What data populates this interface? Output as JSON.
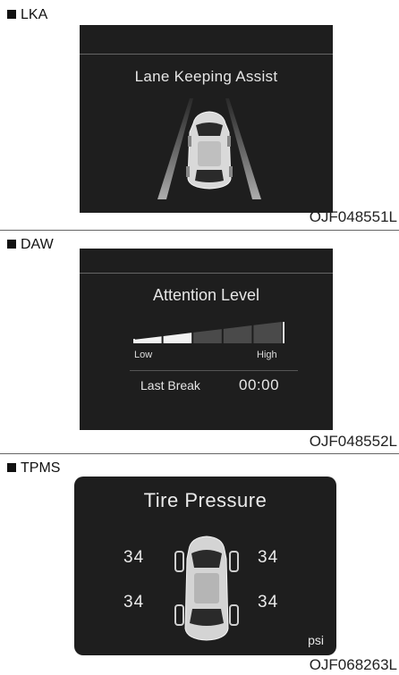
{
  "lka": {
    "section_label": "LKA",
    "screen_title": "Lane Keeping Assist",
    "figure_code": "OJF048551L"
  },
  "daw": {
    "section_label": "DAW",
    "screen_title": "Attention Level",
    "low_label": "Low",
    "high_label": "High",
    "attention_level_filled_segments": 2,
    "attention_level_total_segments": 5,
    "last_break_label": "Last Break",
    "last_break_time": "00:00",
    "figure_code": "OJF048552L"
  },
  "tpms": {
    "section_label": "TPMS",
    "screen_title": "Tire Pressure",
    "front_left": "34",
    "front_right": "34",
    "rear_left": "34",
    "rear_right": "34",
    "unit": "psi",
    "figure_code": "OJF068263L"
  },
  "colors": {
    "screen_bg": "#1e1e1e",
    "screen_text": "#e6e6e6",
    "bar_active": "#f2f2f2",
    "bar_inactive": "#4a4a4a"
  }
}
